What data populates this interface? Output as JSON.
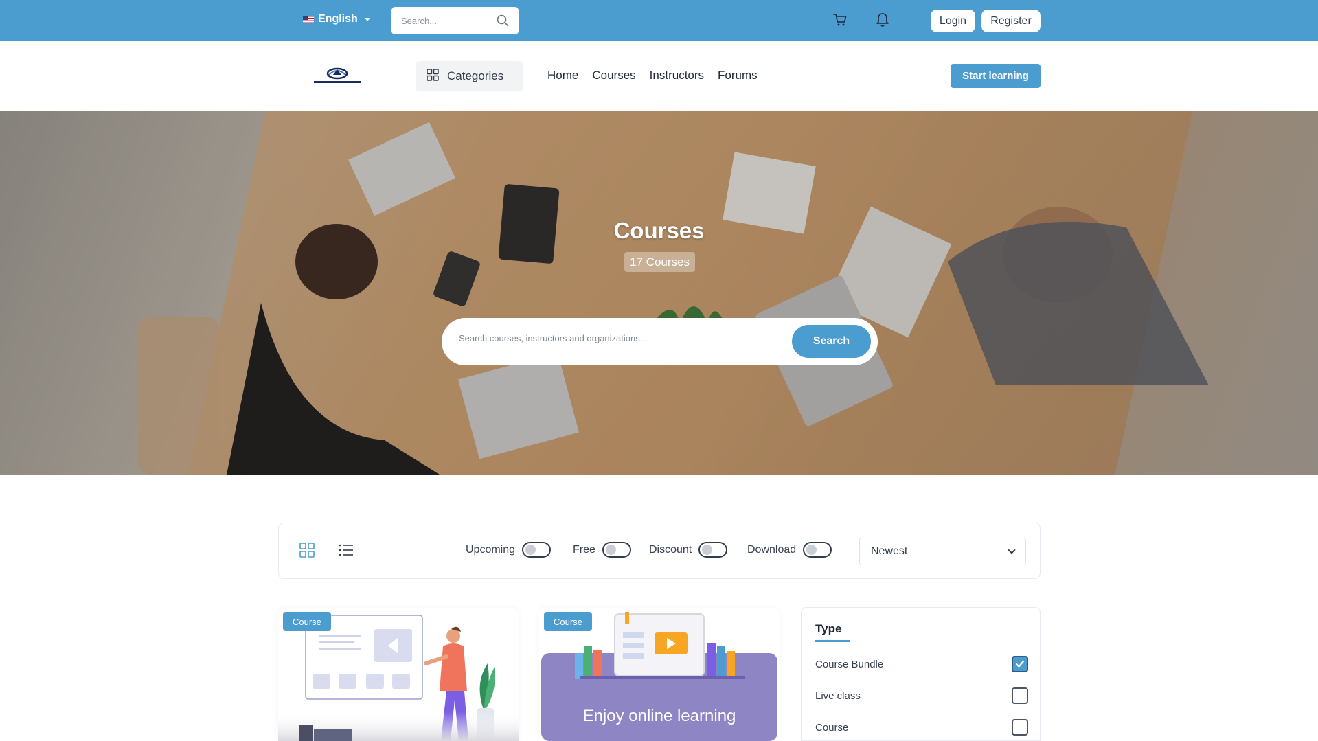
{
  "topbar": {
    "language": "English",
    "search_placeholder": "Search...",
    "login_label": "Login",
    "register_label": "Register"
  },
  "navbar": {
    "logo_alt": "logo",
    "categories_label": "Categories",
    "menu": [
      "Home",
      "Courses",
      "Instructors",
      "Forums"
    ],
    "start_learning_label": "Start learning"
  },
  "hero": {
    "title": "Courses",
    "count_label": "17 Courses",
    "search_placeholder": "Search courses, instructors and organizations...",
    "search_button": "Search"
  },
  "filters": {
    "toggles": [
      "Upcoming",
      "Free",
      "Discount",
      "Download"
    ],
    "sort_selected": "Newest"
  },
  "cards": [
    {
      "badge": "Course",
      "image_caption": ""
    },
    {
      "badge": "Course",
      "image_caption": "Enjoy online learning"
    }
  ],
  "type_filter": {
    "title": "Type",
    "options": [
      {
        "label": "Course Bundle",
        "checked": true
      },
      {
        "label": "Live class",
        "checked": false
      },
      {
        "label": "Course",
        "checked": false
      }
    ]
  },
  "colors": {
    "primary": "#4b9ccf",
    "text": "#1f2a37"
  }
}
